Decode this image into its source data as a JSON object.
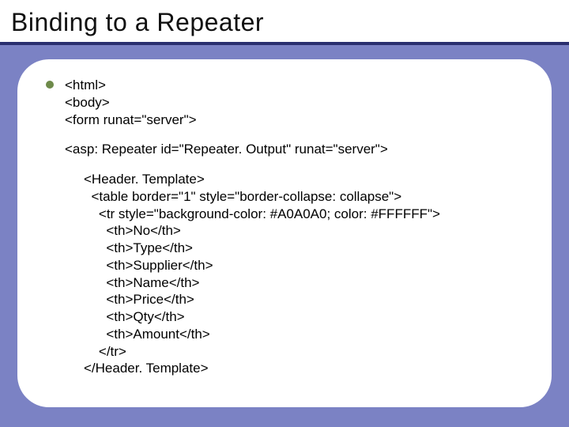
{
  "title": "Binding to a Repeater",
  "code": {
    "l1": "<html>",
    "l2": "<body>",
    "l3": "<form runat=\"server\">",
    "l4": "<asp: Repeater id=\"Repeater. Output\" runat=\"server\">",
    "l5": "<Header. Template>",
    "l6": "  <table border=\"1\" style=\"border-collapse: collapse\">",
    "l7": "    <tr style=\"background-color: #A0A0A0; color: #FFFFFF\">",
    "l8": "      <th>No</th>",
    "l9": "      <th>Type</th>",
    "l10": "      <th>Supplier</th>",
    "l11": "      <th>Name</th>",
    "l12": "      <th>Price</th>",
    "l13": "      <th>Qty</th>",
    "l14": "      <th>Amount</th>",
    "l15": "    </tr>",
    "l16": "</Header. Template>"
  }
}
